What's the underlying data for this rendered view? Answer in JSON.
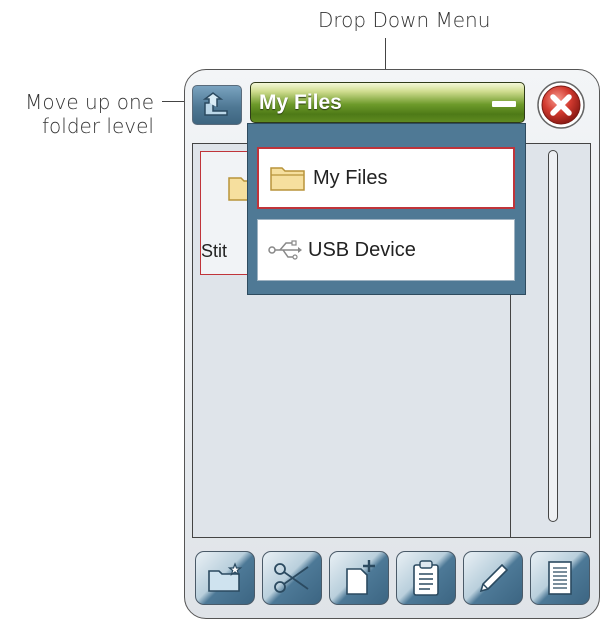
{
  "annotations": {
    "drop_down_menu": "Drop Down Menu",
    "move_up_line1": "Move up one",
    "move_up_line2": "folder level"
  },
  "title_bar": {
    "title": "My Files"
  },
  "file_list": [
    {
      "label": "Stit",
      "icon": "folder-icon"
    }
  ],
  "dropdown": {
    "items": [
      {
        "label": "My Files",
        "icon": "folder-icon",
        "selected": true
      },
      {
        "label": "USB Device",
        "icon": "usb-icon",
        "selected": false
      }
    ]
  },
  "toolbar": {
    "buttons": [
      {
        "name": "new-folder",
        "icon": "new-folder-icon"
      },
      {
        "name": "cut",
        "icon": "scissors-icon"
      },
      {
        "name": "new-file",
        "icon": "new-file-icon"
      },
      {
        "name": "paste",
        "icon": "clipboard-icon"
      },
      {
        "name": "rename",
        "icon": "pencil-icon"
      },
      {
        "name": "info",
        "icon": "document-icon"
      }
    ]
  },
  "colors": {
    "title_bar_green": "#6d9a2a",
    "close_red": "#d23a2f",
    "button_blue": "#4f7894",
    "selection_red": "#c0343a"
  }
}
